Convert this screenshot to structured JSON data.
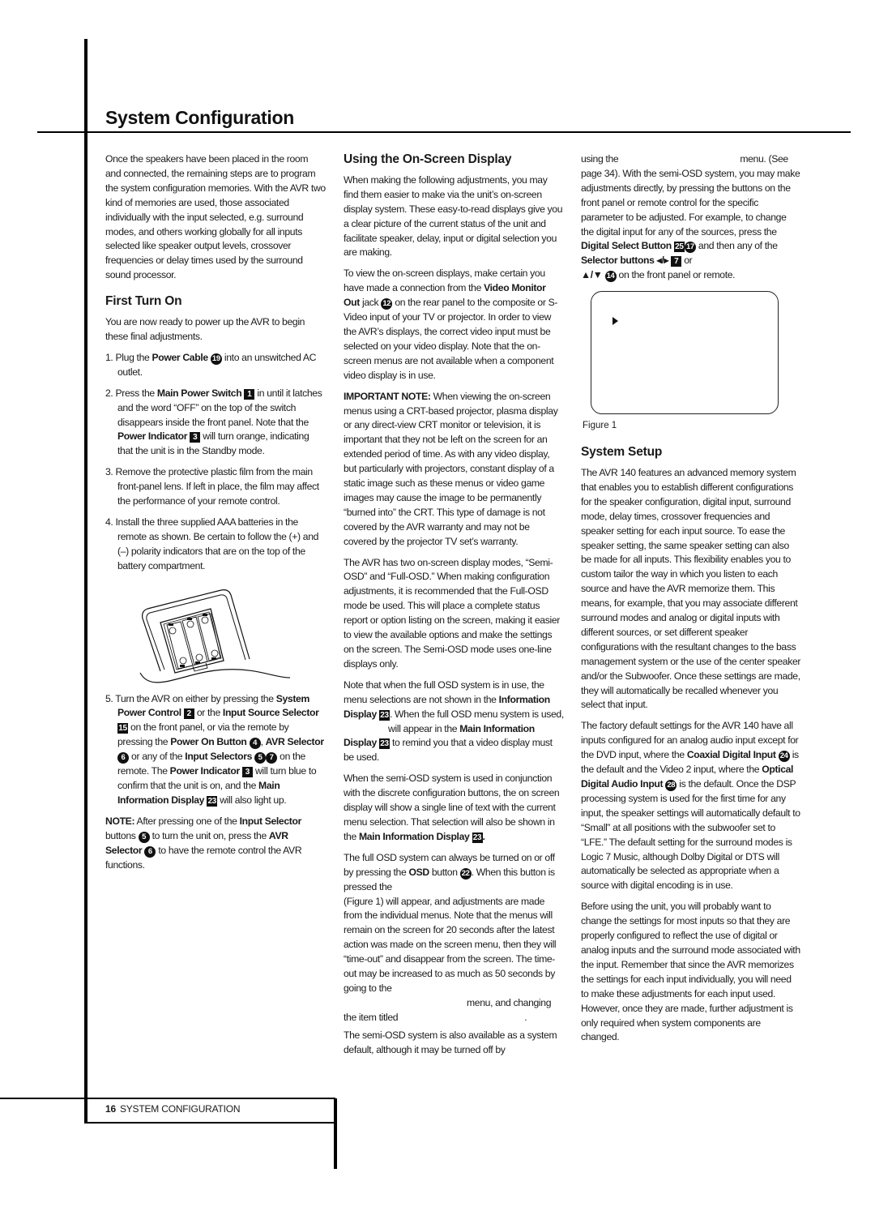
{
  "page": {
    "title": "System Configuration",
    "footer": {
      "page_number": "16",
      "section": "SYSTEM CONFIGURATION"
    }
  },
  "column1": {
    "intro": "Once the speakers have been placed in the room and connected, the remaining steps are to program the system configuration memories. With the AVR two kind of memories are used, those associated individually with the input selected, e.g. surround modes, and others working globally for all inputs selected like speaker output levels, crossover frequencies or delay times used by the surround sound processor.",
    "first_turn_on": {
      "heading": "First Turn On",
      "intro": "You are now ready to power up the AVR to begin these final adjustments.",
      "step1": {
        "num": "1.",
        "pre": "Plug the ",
        "b1": "Power Cable",
        "ref1": "19",
        "post": " into an unswitched AC outlet."
      },
      "step2": {
        "num": "2.",
        "pre": "Press the ",
        "b1": "Main Power Switch",
        "ref1": "1",
        "mid": " in until it latches and the word “OFF” on the top of the switch disappears inside the front panel. Note that the ",
        "b2": "Power Indicator",
        "ref2": "3",
        "post": " will turn orange, indicating that the unit is in the Standby mode."
      },
      "step3": {
        "num": "3.",
        "text": "Remove the protective plastic film from the main front-panel lens. If left in place, the film may affect the performance of your remote control."
      },
      "step4": {
        "num": "4.",
        "text": "Install the three supplied AAA batteries in the remote as shown. Be certain to follow the (+) and (–) polarity indicators that are on the top of the battery compartment."
      },
      "step5": {
        "num": "5.",
        "t1": "Turn the AVR on either by pressing the ",
        "b1": "System Power Control",
        "r1": "2",
        "t2": " or the ",
        "b2": "Input Source Selector",
        "r2": "15",
        "t3": " on the front panel, or via the remote by pressing the ",
        "b3": "Power On Button",
        "r3": "4",
        "t4": ", ",
        "b4": "AVR Selector",
        "r4": "6",
        "t5": " or any of the ",
        "b5": "Input Selectors",
        "r5a": "5",
        "r5b": "7",
        "t6": " on the remote. The ",
        "b6": "Power Indicator",
        "r6": "3",
        "t7": " will turn blue to confirm that the unit is on, and the ",
        "b7": "Main Information Display",
        "r7": "23",
        "t8": " will also light up."
      },
      "note": {
        "label": "NOTE:",
        "t1": " After pressing one of the ",
        "b1": "Input Selector",
        "t2": " buttons ",
        "r1": "5",
        "t3": " to turn the unit on, press the ",
        "b2": "AVR Selector",
        "r2": "6",
        "t4": " to have the remote control the AVR functions."
      }
    }
  },
  "column2": {
    "heading": "Using the On-Screen Display",
    "p1": "When making the following adjustments, you may find them easier to make via the unit’s on-screen display system. These easy-to-read displays give you a clear picture of the current status of the unit and facilitate speaker, delay, input or digital selection you are making.",
    "p2": {
      "t1": "To view the on-screen displays, make certain you have made a connection from the ",
      "b1": "Video Monitor Out",
      "t2": " jack ",
      "r1": "12",
      "t3": " on the rear panel to the composite or S-Video input of your TV or projector. In order to view the AVR’s displays, the correct video input must be selected on your video display. Note that the on-screen menus are not available when a component video display is in use."
    },
    "p3": {
      "label": "IMPORTANT NOTE:",
      "text": " When viewing the on-screen menus using a CRT-based projector, plasma display or any direct-view CRT monitor or television, it is important that they not be left on the screen for an extended period of time. As with any video display, but particularly with projectors, constant display of a static image such as these menus or video game images may cause the image to be permanently “burned into” the CRT. This type of damage is not covered by the AVR warranty and may not be covered by the projector TV set’s warranty."
    },
    "p4": "The AVR has two on-screen display modes, “Semi-OSD” and “Full-OSD.” When making configuration adjustments, it is recommended that the Full-OSD mode be used. This will place a complete status report or option listing on the screen, making it easier to view the available options and make the settings on the screen. The Semi-OSD mode uses one-line displays only.",
    "p5": {
      "t1": "Note that when the full OSD system is in use, the menu selections are not shown in the ",
      "b1": "Information Display",
      "r1": "23",
      "t2": ". When the full OSD menu system is used,",
      "t3": " will appear in the ",
      "b2": "Main Information Display",
      "r2": "23",
      "t4": " to remind you that a video display must be used."
    },
    "p6": {
      "t1": "When the semi-OSD system is used in conjunction with the discrete configuration buttons, the on screen display will show a single line of text with the current menu selection. That selection will also be shown in the ",
      "b1": "Main Information Display",
      "r1": "23",
      "t2": "."
    },
    "p7": {
      "t1": "The full OSD system can always be turned on or off by pressing the ",
      "b1": "OSD",
      "t2": " button ",
      "r1": "22",
      "t3": ". When this button is pressed the",
      "t4": "(Figure 1) will appear, and adjustments are made from the individual menus. Note that the menus will remain on the screen for 20 seconds after the latest action was made on the screen menu, then they will “time-out” and disappear from the screen. The time-out may be increased to as much as 50 seconds by going to the",
      "t5": "menu, and changing",
      "t6": "the item titled",
      "t7": "."
    },
    "p8": "The semi-OSD system is also available as a system default, although it may be turned off by"
  },
  "column3": {
    "p1": {
      "t1": "using the",
      "t2": "menu. (See page 34). With the semi-OSD system, you may make adjustments directly, by pressing the buttons on the front panel or remote control for the specific parameter to be adjusted. For example, to change the digital input for any of the sources, press the ",
      "b1": "Digital Select Button",
      "r1a": "25",
      "r1b": "17",
      "t3": " and then any of the ",
      "b2": "Selector buttons ◂/▸",
      "r2": "7",
      "t4": " or ",
      "arrows": "▲/▼",
      "r3": "14",
      "t5": " on the front panel or remote."
    },
    "figure_caption": "Figure 1",
    "heading": "System Setup",
    "p2": "The AVR 140 features an advanced memory system that enables you to establish different configurations for the speaker configuration, digital input, surround mode, delay times, crossover frequencies and speaker setting for each input source. To ease the speaker setting, the same speaker setting can also be made for all inputs. This flexibility enables you to custom tailor the way in which you listen to each source and have the AVR memorize them. This means, for example, that you may associate different surround modes and analog or digital inputs with different sources, or set different speaker configurations with the resultant changes to the bass management system or the use of the center speaker and/or the Subwoofer. Once these settings are made, they will automatically be recalled whenever you select that input.",
    "p3": {
      "t1": "The factory default settings for the AVR 140 have all inputs configured for an analog audio input except for the DVD input, where the ",
      "b1": "Coaxial Digital Input",
      "r1": "24",
      "t2": " is the default and the Video 2 input, where the ",
      "b2": "Optical Digital Audio Input",
      "r2": "28",
      "t3": " is the default. Once the DSP processing system is used for the first time for any input, the speaker settings will automatically default to “Small” at all positions with the subwoofer set to “LFE.” The default setting for the surround modes is Logic 7 Music, although Dolby Digital or DTS will automatically be selected as appropriate when a source with digital encoding is in use."
    },
    "p4": "Before using the unit, you will probably want to change the settings for most inputs so that they are properly configured to reflect the use of digital or analog inputs and the surround mode associated with the input. Remember that since the AVR memorizes the settings for each input individually, you will need to make these adjustments for each input used. However, once they are made, further adjustment is only required when system components are changed."
  }
}
